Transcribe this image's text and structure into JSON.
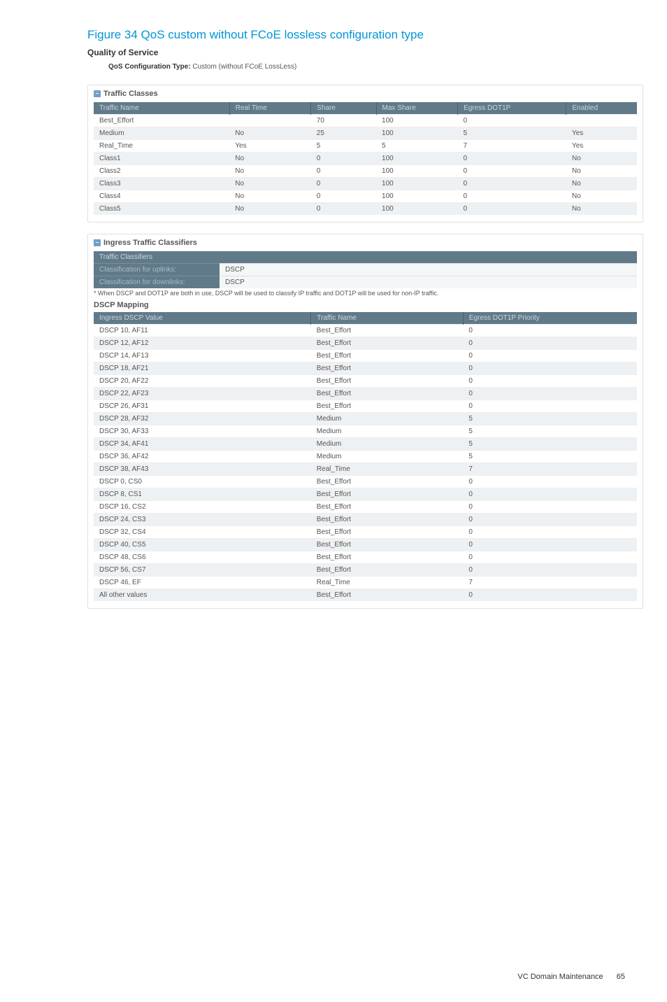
{
  "figure_title": "Figure 34 QoS custom without FCoE lossless configuration type",
  "qos_heading": "Quality of Service",
  "config_type_label": "QoS Configuration Type:",
  "config_type_value": "Custom (without FCoE LossLess)",
  "traffic_classes": {
    "title": "Traffic Classes",
    "headers": [
      "Traffic Name",
      "Real Time",
      "Share",
      "Max Share",
      "Egress DOT1P",
      "Enabled"
    ],
    "rows": [
      {
        "name": "Best_Effort",
        "realtime": "",
        "share": "70",
        "maxshare": "100",
        "egress": "0",
        "enabled": ""
      },
      {
        "name": "Medium",
        "realtime": "No",
        "share": "25",
        "maxshare": "100",
        "egress": "5",
        "enabled": "Yes"
      },
      {
        "name": "Real_Time",
        "realtime": "Yes",
        "share": "5",
        "maxshare": "5",
        "egress": "7",
        "enabled": "Yes"
      },
      {
        "name": "Class1",
        "realtime": "No",
        "share": "0",
        "maxshare": "100",
        "egress": "0",
        "enabled": "No"
      },
      {
        "name": "Class2",
        "realtime": "No",
        "share": "0",
        "maxshare": "100",
        "egress": "0",
        "enabled": "No"
      },
      {
        "name": "Class3",
        "realtime": "No",
        "share": "0",
        "maxshare": "100",
        "egress": "0",
        "enabled": "No"
      },
      {
        "name": "Class4",
        "realtime": "No",
        "share": "0",
        "maxshare": "100",
        "egress": "0",
        "enabled": "No"
      },
      {
        "name": "Class5",
        "realtime": "No",
        "share": "0",
        "maxshare": "100",
        "egress": "0",
        "enabled": "No"
      }
    ]
  },
  "ingress_classifiers": {
    "title": "Ingress Traffic Classifiers",
    "classifiers_header": "Traffic Classifiers",
    "uplinks_label": "Classification for uplinks:",
    "uplinks_value": "DSCP",
    "downlinks_label": "Classification for downlinks:",
    "downlinks_value": "DSCP",
    "footnote": "* When DSCP and DOT1P are both in use, DSCP will be used to classify IP traffic and DOT1P will be used for non-IP traffic.",
    "mapping_title": "DSCP Mapping",
    "mapping_headers": [
      "Ingress DSCP Value",
      "Traffic Name",
      "Egress DOT1P Priority"
    ],
    "mapping_rows": [
      {
        "dscp": "DSCP 10, AF11",
        "traffic": "Best_Effort",
        "priority": "0"
      },
      {
        "dscp": "DSCP 12, AF12",
        "traffic": "Best_Effort",
        "priority": "0"
      },
      {
        "dscp": "DSCP 14, AF13",
        "traffic": "Best_Effort",
        "priority": "0"
      },
      {
        "dscp": "DSCP 18, AF21",
        "traffic": "Best_Effort",
        "priority": "0"
      },
      {
        "dscp": "DSCP 20, AF22",
        "traffic": "Best_Effort",
        "priority": "0"
      },
      {
        "dscp": "DSCP 22, AF23",
        "traffic": "Best_Effort",
        "priority": "0"
      },
      {
        "dscp": "DSCP 26, AF31",
        "traffic": "Best_Effort",
        "priority": "0"
      },
      {
        "dscp": "DSCP 28, AF32",
        "traffic": "Medium",
        "priority": "5"
      },
      {
        "dscp": "DSCP 30, AF33",
        "traffic": "Medium",
        "priority": "5"
      },
      {
        "dscp": "DSCP 34, AF41",
        "traffic": "Medium",
        "priority": "5"
      },
      {
        "dscp": "DSCP 36, AF42",
        "traffic": "Medium",
        "priority": "5"
      },
      {
        "dscp": "DSCP 38, AF43",
        "traffic": "Real_Time",
        "priority": "7"
      },
      {
        "dscp": "DSCP 0, CS0",
        "traffic": "Best_Effort",
        "priority": "0"
      },
      {
        "dscp": "DSCP 8, CS1",
        "traffic": "Best_Effort",
        "priority": "0"
      },
      {
        "dscp": "DSCP 16, CS2",
        "traffic": "Best_Effort",
        "priority": "0"
      },
      {
        "dscp": "DSCP 24, CS3",
        "traffic": "Best_Effort",
        "priority": "0"
      },
      {
        "dscp": "DSCP 32, CS4",
        "traffic": "Best_Effort",
        "priority": "0"
      },
      {
        "dscp": "DSCP 40, CS5",
        "traffic": "Best_Effort",
        "priority": "0"
      },
      {
        "dscp": "DSCP 48, CS6",
        "traffic": "Best_Effort",
        "priority": "0"
      },
      {
        "dscp": "DSCP 56, CS7",
        "traffic": "Best_Effort",
        "priority": "0"
      },
      {
        "dscp": "DSCP 46, EF",
        "traffic": "Real_Time",
        "priority": "7"
      },
      {
        "dscp": "All other values",
        "traffic": "Best_Effort",
        "priority": "0"
      }
    ]
  },
  "footer": {
    "section": "VC Domain Maintenance",
    "page": "65"
  }
}
